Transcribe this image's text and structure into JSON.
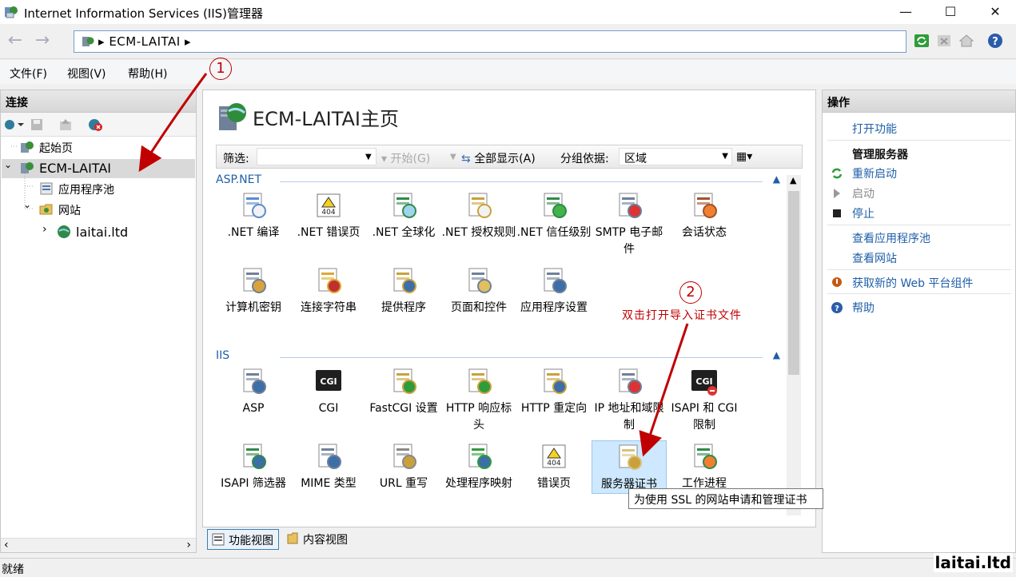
{
  "window": {
    "title": "Internet Information Services (IIS)管理器",
    "minimize": "—",
    "maximize": "☐",
    "close": "✕"
  },
  "address": {
    "path_sep": "▸",
    "path": "ECM-LAITAI",
    "path_end": "▸"
  },
  "menu": [
    "文件(F)",
    "视图(V)",
    "帮助(H)"
  ],
  "connections": {
    "title": "连接",
    "tree": {
      "start_page": "起始页",
      "server": "ECM-LAITAI",
      "app_pools": "应用程序池",
      "sites": "网站",
      "site": "laitai.ltd"
    }
  },
  "center": {
    "title": "ECM-LAITAI主页",
    "filter": {
      "label": "筛选:",
      "start": "开始(G)",
      "show_all": "全部显示(A)",
      "group_by_label": "分组依据:",
      "group_by_value": "区域"
    },
    "sections": [
      {
        "name": "ASP.NET",
        "items": [
          {
            "label": ".NET 编译",
            "icon": "net-compilation-icon"
          },
          {
            "label": ".NET 错误页",
            "icon": "net-error-pages-icon"
          },
          {
            "label": ".NET 全球化",
            "icon": "net-globalization-icon"
          },
          {
            "label": ".NET 授权规则",
            "icon": "net-authorization-icon"
          },
          {
            "label": ".NET 信任级别",
            "icon": "net-trust-levels-icon"
          },
          {
            "label": "SMTP 电子邮件",
            "icon": "smtp-email-icon"
          },
          {
            "label": "会话状态",
            "icon": "session-state-icon"
          },
          {
            "label": "计算机密钥",
            "icon": "machine-key-icon"
          },
          {
            "label": "连接字符串",
            "icon": "connection-strings-icon"
          },
          {
            "label": "提供程序",
            "icon": "providers-icon"
          },
          {
            "label": "页面和控件",
            "icon": "pages-controls-icon"
          },
          {
            "label": "应用程序设置",
            "icon": "app-settings-icon"
          }
        ]
      },
      {
        "name": "IIS",
        "items": [
          {
            "label": "ASP",
            "icon": "asp-icon"
          },
          {
            "label": "CGI",
            "icon": "cgi-icon"
          },
          {
            "label": "FastCGI 设置",
            "icon": "fastcgi-icon"
          },
          {
            "label": "HTTP 响应标头",
            "icon": "http-headers-icon"
          },
          {
            "label": "HTTP 重定向",
            "icon": "http-redirect-icon"
          },
          {
            "label": "IP 地址和域限制",
            "icon": "ip-restrictions-icon"
          },
          {
            "label": "ISAPI 和 CGI 限制",
            "icon": "isapi-cgi-icon"
          },
          {
            "label": "ISAPI 筛选器",
            "icon": "isapi-filters-icon"
          },
          {
            "label": "MIME 类型",
            "icon": "mime-types-icon"
          },
          {
            "label": "URL 重写",
            "icon": "url-rewrite-icon"
          },
          {
            "label": "处理程序映射",
            "icon": "handler-mappings-icon"
          },
          {
            "label": "错误页",
            "icon": "error-pages-icon"
          },
          {
            "label": "服务器证书",
            "icon": "server-certificates-icon"
          },
          {
            "label": "工作进程",
            "icon": "worker-processes-icon"
          }
        ]
      }
    ],
    "tooltip": "为使用 SSL 的网站申请和管理证书"
  },
  "view_tabs": {
    "features": "功能视图",
    "content": "内容视图"
  },
  "actions": {
    "title": "操作",
    "open_feature": "打开功能",
    "manage_server": "管理服务器",
    "restart": "重新启动",
    "start": "启动",
    "stop": "停止",
    "view_app_pools": "查看应用程序池",
    "view_sites": "查看网站",
    "get_web_platform": "获取新的 Web 平台组件",
    "help": "帮助"
  },
  "status": {
    "text": "就绪"
  },
  "watermark": "laitai.ltd",
  "annotations": {
    "step1": "1",
    "step2": "2",
    "step2_text": "双击打开导入证书文件"
  },
  "colors": {
    "link": "#1f5fa8",
    "annotation": "#c00000",
    "selection": "#cde8ff"
  }
}
